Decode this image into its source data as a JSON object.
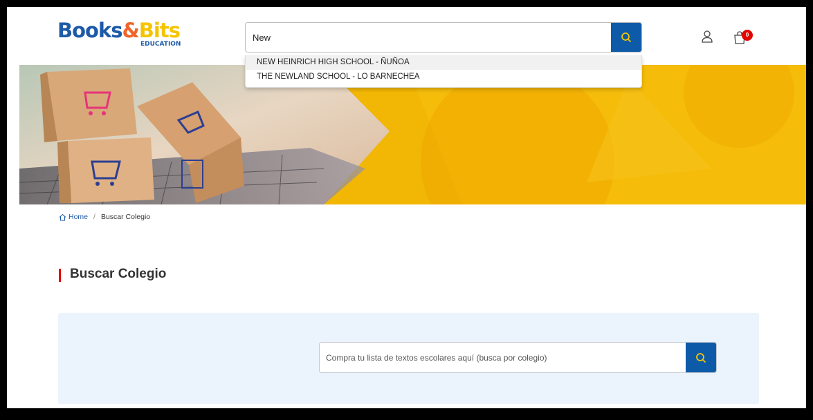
{
  "header": {
    "logo": {
      "part1": "Books",
      "amp": "&",
      "part2": "Bits",
      "sub": "EDUCATION"
    },
    "search": {
      "value": "New",
      "placeholder": "",
      "button_icon": "search-icon"
    },
    "suggestions": [
      "NEW HEINRICH HIGH SCHOOL - ÑUÑOA",
      "THE NEWLAND SCHOOL - LO BARNECHEA"
    ],
    "user_icon": "user-icon",
    "cart": {
      "icon": "shopping-bag-icon",
      "count": "0"
    }
  },
  "breadcrumb": {
    "home": "Home",
    "current": "Buscar Colegio"
  },
  "page_title": "Buscar Colegio",
  "school_search": {
    "placeholder": "Compra tu lista de textos escolares aquí (busca por colegio)",
    "value": "",
    "button_icon": "search-icon"
  },
  "colors": {
    "brand_blue": "#0d5ba8",
    "accent_red": "#e10600",
    "banner_yellow": "#f2b705",
    "panel_bg": "#ebf3fc"
  }
}
